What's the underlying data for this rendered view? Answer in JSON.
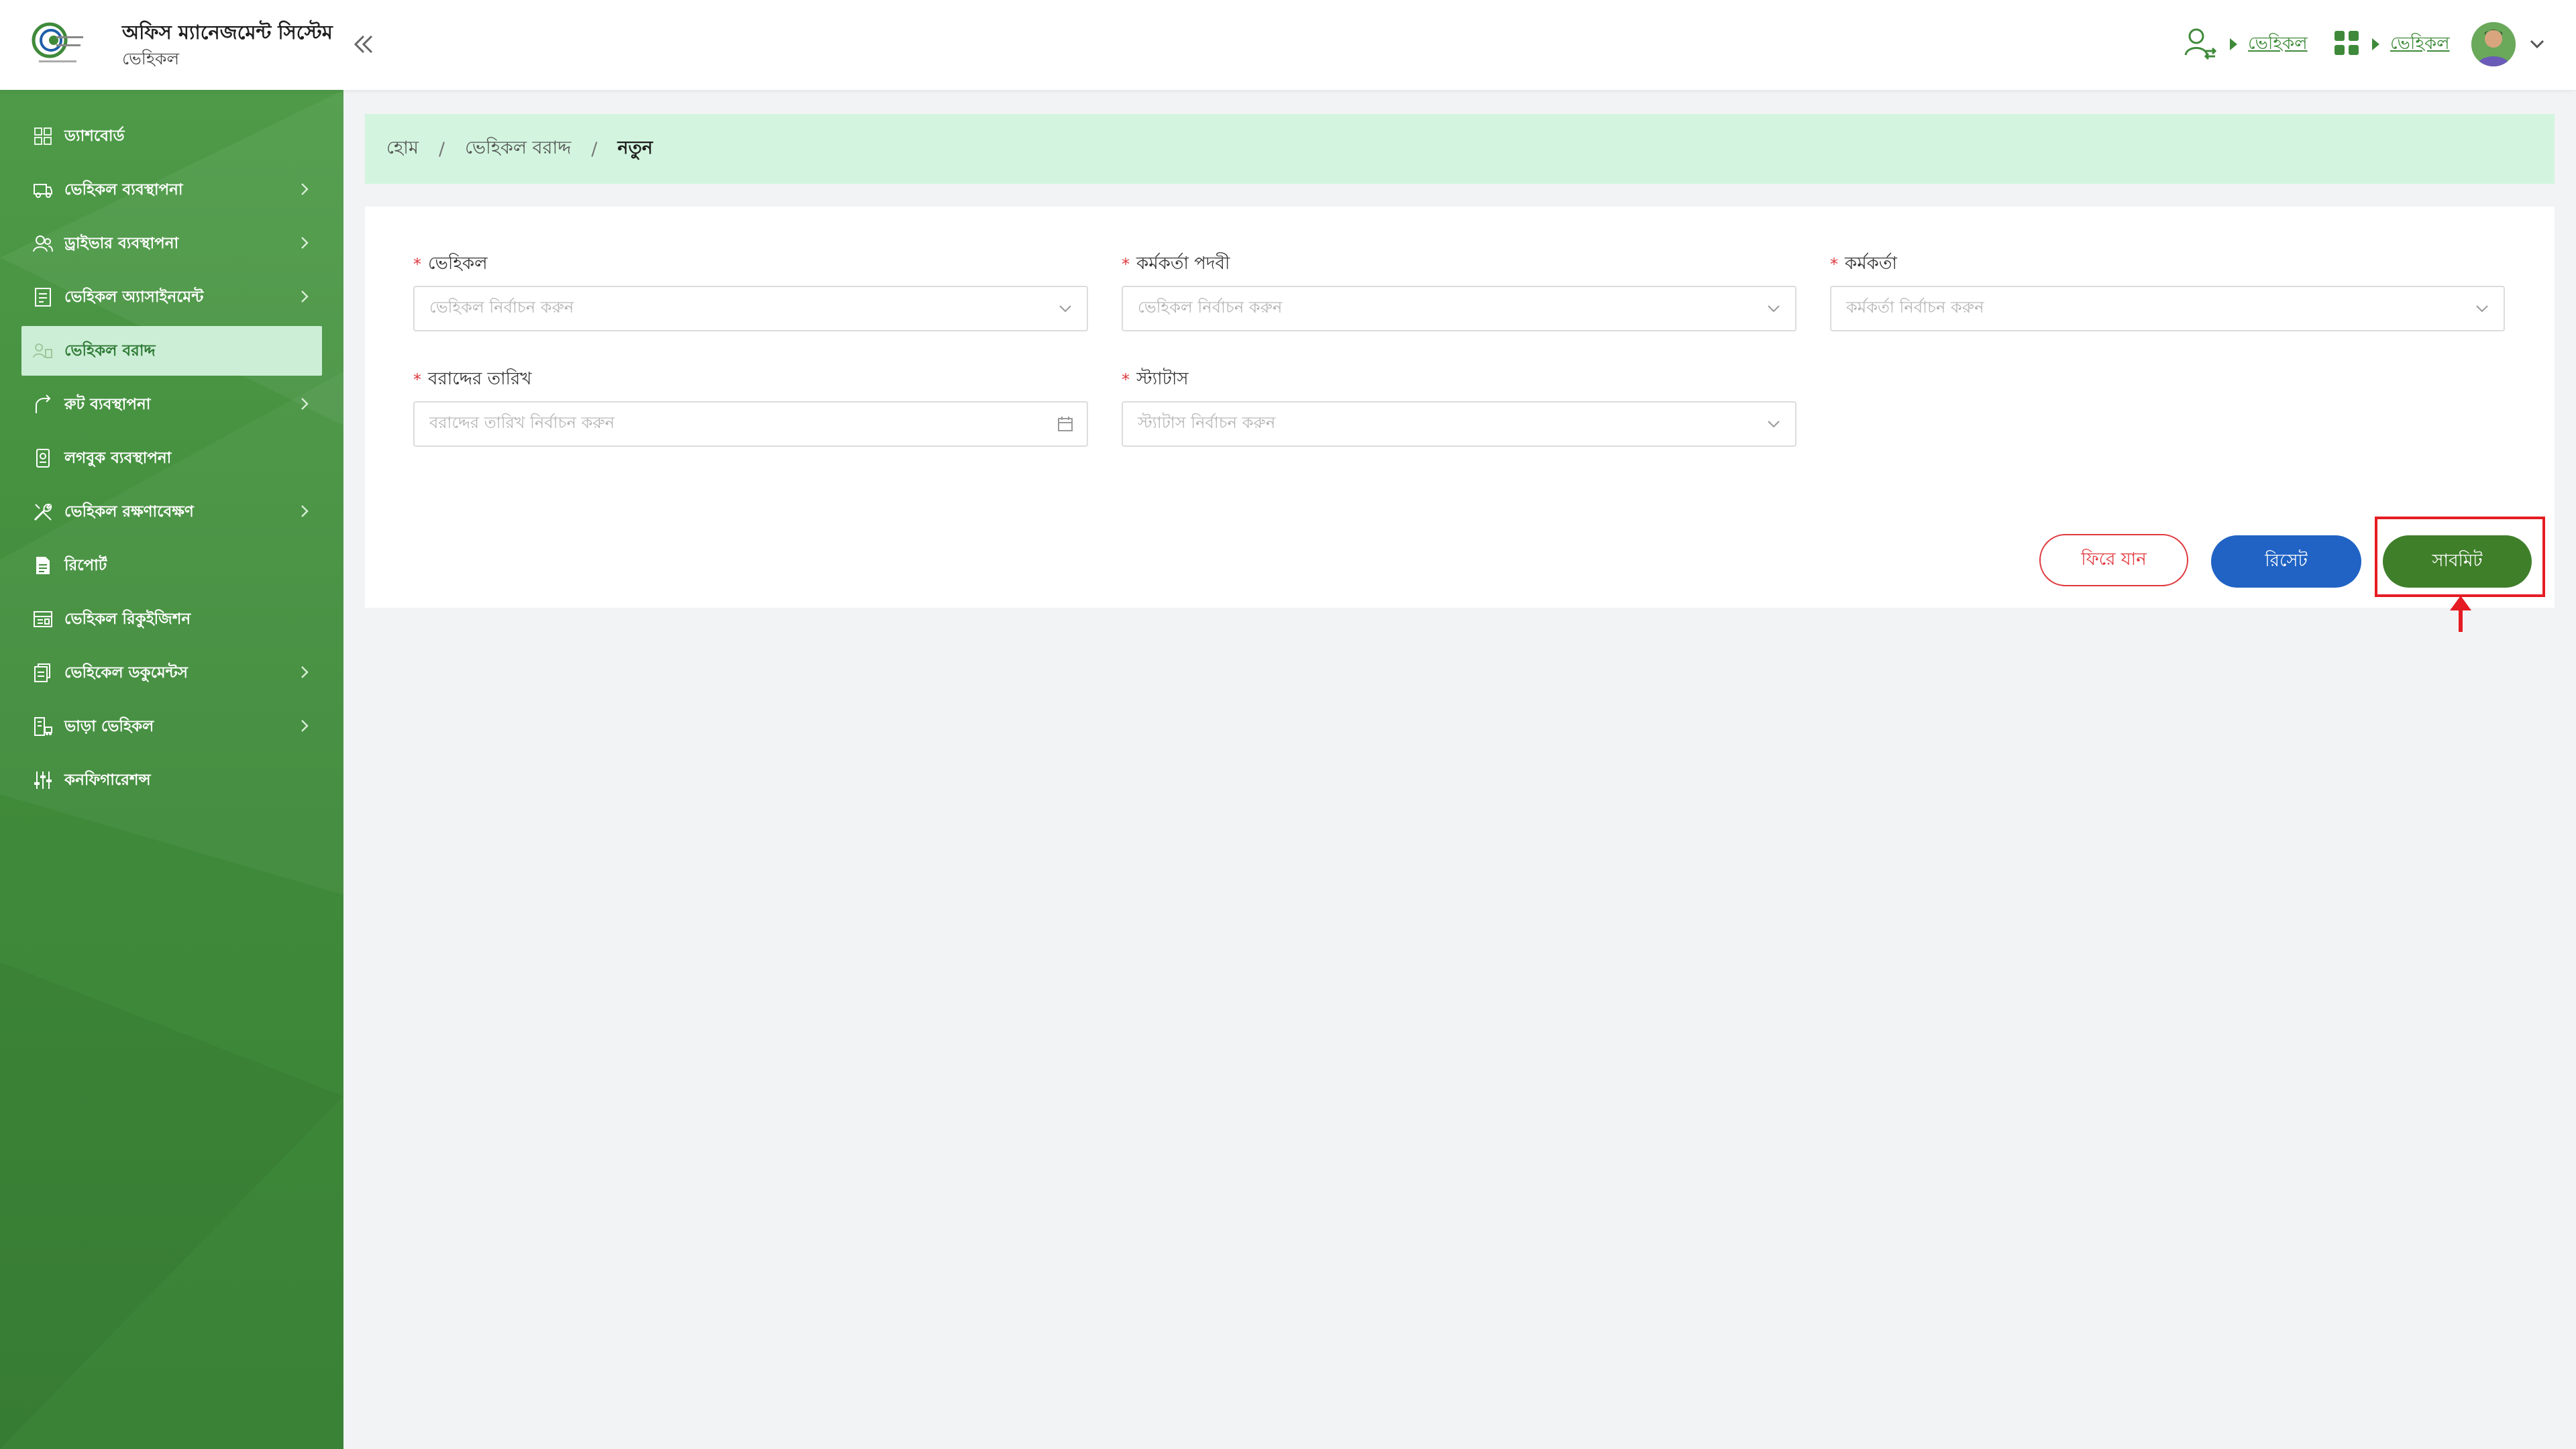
{
  "header": {
    "app_title": "অফিস ম্যানেজমেন্ট সিস্টেম",
    "app_subtitle": "ভেহিকল",
    "links": [
      "ভেহিকল",
      "ভেহিকল"
    ],
    "icons": {
      "collapse": "double-chevron-left-icon",
      "user_switch": "user-switch-icon",
      "apps": "apps-grid-icon",
      "avatar": "user-avatar",
      "dropdown": "chevron-down-icon"
    }
  },
  "sidebar": {
    "items": [
      {
        "label": "ড্যাশবোর্ড",
        "icon": "dashboard-icon",
        "has_children": false,
        "active": false
      },
      {
        "label": "ভেহিকল ব্যবস্থাপনা",
        "icon": "vehicle-icon",
        "has_children": true,
        "active": false
      },
      {
        "label": "ড্রাইভার ব্যবস্থাপনা",
        "icon": "drivers-icon",
        "has_children": true,
        "active": false
      },
      {
        "label": "ভেহিকল অ্যাসাইনমেন্ট",
        "icon": "assignment-icon",
        "has_children": true,
        "active": false
      },
      {
        "label": "ভেহিকল বরাদ্দ",
        "icon": "allocation-icon",
        "has_children": false,
        "active": true
      },
      {
        "label": "রুট ব্যবস্থাপনা",
        "icon": "route-icon",
        "has_children": true,
        "active": false
      },
      {
        "label": "লগবুক ব্যবস্থাপনা",
        "icon": "logbook-icon",
        "has_children": false,
        "active": false
      },
      {
        "label": "ভেহিকল রক্ষণাবেক্ষণ",
        "icon": "maintenance-icon",
        "has_children": true,
        "active": false
      },
      {
        "label": "রিপোর্ট",
        "icon": "report-icon",
        "has_children": false,
        "active": false
      },
      {
        "label": "ভেহিকল রিকুইজিশন",
        "icon": "requisition-icon",
        "has_children": false,
        "active": false
      },
      {
        "label": "ভেহিকেল ডকুমেন্টস",
        "icon": "documents-icon",
        "has_children": true,
        "active": false
      },
      {
        "label": "ভাড়া ভেহিকল",
        "icon": "rental-vehicle-icon",
        "has_children": true,
        "active": false
      },
      {
        "label": "কনফিগারেশন্স",
        "icon": "configuration-icon",
        "has_children": false,
        "active": false
      }
    ]
  },
  "breadcrumb": {
    "home": "হোম",
    "section": "ভেহিকল বরাদ্দ",
    "current": "নতুন"
  },
  "form": {
    "fields": [
      {
        "label": "ভেহিকল",
        "placeholder": "ভেহিকল নির্বাচন করুন",
        "required": true,
        "type": "select"
      },
      {
        "label": "কর্মকর্তা পদবী",
        "placeholder": "ভেহিকল নির্বাচন করুন",
        "required": true,
        "type": "select"
      },
      {
        "label": "কর্মকর্তা",
        "placeholder": "কর্মকর্তা নির্বাচন করুন",
        "required": true,
        "type": "select"
      },
      {
        "label": "বরাদ্দের তারিখ",
        "placeholder": "বরাদ্দের তারিখ নির্বাচন করুন",
        "required": true,
        "type": "date"
      },
      {
        "label": "স্ট্যাটাস",
        "placeholder": "স্ট্যাটাস নির্বাচন করুন",
        "required": true,
        "type": "select"
      }
    ],
    "required_mark": "*"
  },
  "buttons": {
    "back": "ফিরে যান",
    "reset": "রিসেট",
    "submit": "সাবমিট"
  },
  "colors": {
    "sidebar_green": "#3f8a3a",
    "active_item_bg": "#cdeed6",
    "breadcrumb_bg": "#d3f5df",
    "submit_green": "#3f7f2a",
    "reset_blue": "#2063c4",
    "back_red": "#e0383e",
    "highlight_red": "#e51c23"
  }
}
